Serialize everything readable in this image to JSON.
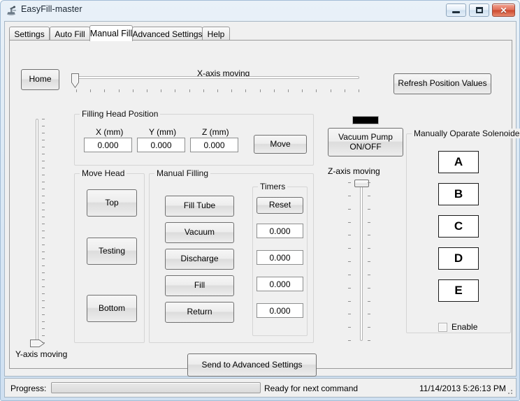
{
  "window": {
    "title": "EasyFill-master",
    "app_icon": "machine-icon",
    "controls": {
      "minimize": "minimize-icon",
      "maximize": "maximize-icon",
      "close": "close-icon"
    },
    "frame_color": "#cfe0f1",
    "client_color": "#f0f0f0"
  },
  "tabs": [
    {
      "label": "Settings",
      "active": false
    },
    {
      "label": "Auto Fill",
      "active": false
    },
    {
      "label": "Manual Fill",
      "active": true
    },
    {
      "label": "Advanced Settings",
      "active": false
    },
    {
      "label": "Help",
      "active": false
    }
  ],
  "toolbar": {
    "home_label": "Home",
    "refresh_label": "Refresh Position Values"
  },
  "axes": {
    "x_label": "X-axis moving",
    "y_label": "Y-axis moving",
    "z_label": "Z-axis moving"
  },
  "filling_head_position": {
    "title": "Filling Head Position",
    "fields": [
      {
        "label": "X (mm)",
        "value": "0.000"
      },
      {
        "label": "Y (mm)",
        "value": "0.000"
      },
      {
        "label": "Z (mm)",
        "value": "0.000"
      }
    ],
    "move_label": "Move"
  },
  "vacuum_pump": {
    "button_line1": "Vacuum Pump",
    "button_line2": "ON/OFF",
    "indicator_color": "#000000"
  },
  "move_head": {
    "title": "Move Head",
    "buttons": [
      {
        "label": "Top"
      },
      {
        "label": "Testing"
      },
      {
        "label": "Bottom"
      }
    ]
  },
  "manual_filling": {
    "title": "Manual Filling",
    "buttons": [
      {
        "label": "Fill Tube"
      },
      {
        "label": "Vacuum"
      },
      {
        "label": "Discharge"
      },
      {
        "label": "Fill"
      },
      {
        "label": "Return"
      }
    ]
  },
  "timers": {
    "title": "Timers",
    "reset_label": "Reset",
    "values": [
      "0.000",
      "0.000",
      "0.000",
      "0.000"
    ]
  },
  "solenoid": {
    "title": "Manually Oparate Solenoide",
    "buttons": [
      {
        "label": "A"
      },
      {
        "label": "B"
      },
      {
        "label": "C"
      },
      {
        "label": "D"
      },
      {
        "label": "E"
      }
    ],
    "enable_label": "Enable",
    "enable_checked": false
  },
  "send_button": {
    "label": "Send to Advanced Settings"
  },
  "statusbar": {
    "progress_label": "Progress:",
    "progress_value": 0,
    "message": "Ready for next command",
    "datetime": "11/14/2013 5:26:13 PM"
  }
}
